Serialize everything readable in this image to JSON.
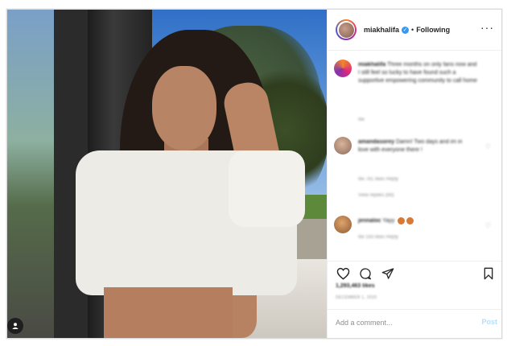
{
  "post": {
    "username": "miakhalifa",
    "verified_glyph": "✓",
    "separator": "•",
    "follow_label": "Following",
    "more_glyph": "···"
  },
  "comments": [
    {
      "username": "miakhalifa",
      "text": "Three months on only fans now and I still feel so lucky to have found such a supportive empowering community to call home",
      "time": "9w",
      "meta": ""
    },
    {
      "username": "amandasorey",
      "text": "Damn! Two days and im in love with everyone there !",
      "time": "9w",
      "meta": "781 likes   Reply",
      "replies": "View replies (69)"
    },
    {
      "username": "jennaloc",
      "text": "Yayy",
      "time": "9w",
      "meta": "193 likes   Reply",
      "replies": ""
    }
  ],
  "likes": "1,293,463 likes",
  "date": "DECEMBER 1, 2020",
  "add_comment": {
    "placeholder": "Add a comment...",
    "post_label": "Post"
  },
  "icons": [
    "heart-icon",
    "comment-icon",
    "share-icon",
    "bookmark-icon",
    "user-tag-icon",
    "more-options-icon",
    "verified-badge-icon"
  ],
  "colors": {
    "accent": "#3897f0",
    "post_disabled": "#b2dffc",
    "border": "#dbdbdb"
  }
}
